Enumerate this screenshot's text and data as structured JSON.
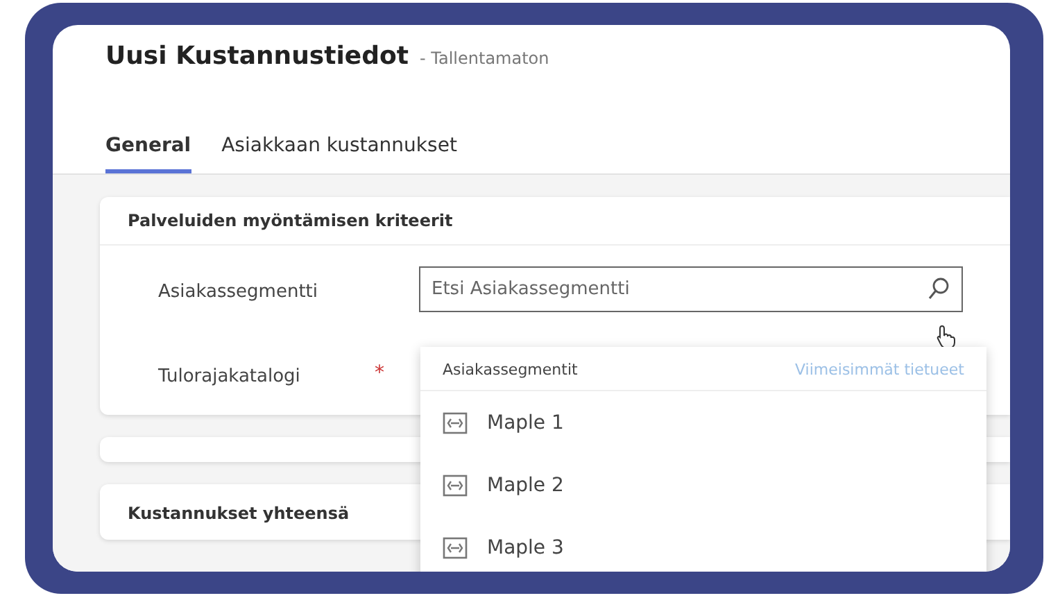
{
  "header": {
    "title": "Uusi Kustannustiedot",
    "status": "- Tallentamaton"
  },
  "tabs": [
    {
      "label": "General",
      "selected": true
    },
    {
      "label": "Asiakkaan kustannukset",
      "selected": false
    }
  ],
  "section": {
    "title": "Palveluiden myöntämisen kriteerit",
    "fields": [
      {
        "label": "Asiakassegmentti",
        "placeholder": "Etsi Asiakassegmentti"
      },
      {
        "label": "Tulorajakatalogi",
        "required_mark": "*"
      }
    ]
  },
  "dropdown": {
    "heading": "Asiakassegmentit",
    "link": "Viimeisimmät tietueet",
    "items": [
      {
        "label": "Maple 1"
      },
      {
        "label": "Maple 2"
      },
      {
        "label": "Maple 3"
      }
    ]
  },
  "totals": {
    "title": "Kustannukset yhteensä"
  }
}
